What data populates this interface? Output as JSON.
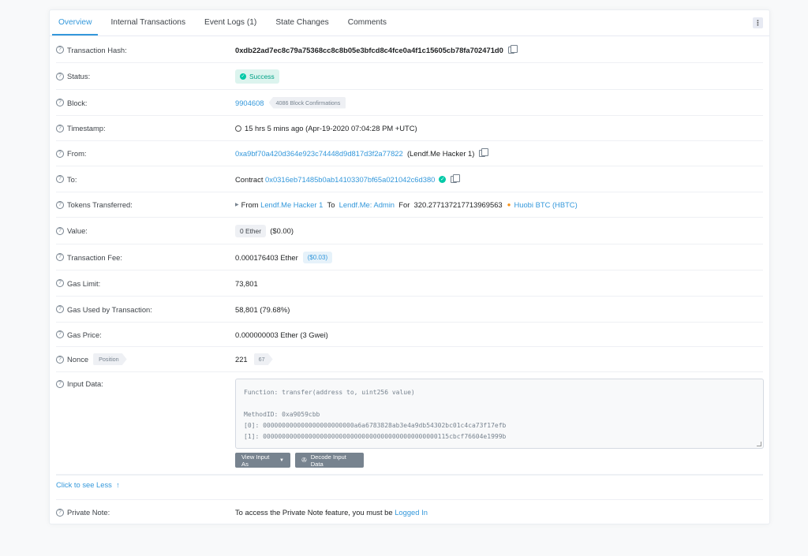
{
  "tabs": [
    "Overview",
    "Internal Transactions",
    "Event Logs (1)",
    "State Changes",
    "Comments"
  ],
  "kebab": "⋮",
  "rows": {
    "hash": {
      "label": "Transaction Hash:",
      "value": "0xdb22ad7ec8c79a75368cc8c8b05e3bfcd8c4fce0a4f1c15605cb78fa702471d0"
    },
    "status": {
      "label": "Status:",
      "value": "Success"
    },
    "block": {
      "label": "Block:",
      "number": "9904608",
      "confirmations": "4086 Block Confirmations"
    },
    "timestamp": {
      "label": "Timestamp:",
      "value": "15 hrs 5 mins ago (Apr-19-2020 07:04:28 PM +UTC)"
    },
    "from": {
      "label": "From:",
      "address": "0xa9bf70a420d364e923c74448d9d817d3f2a77822",
      "name": "(Lendf.Me Hacker 1)"
    },
    "to": {
      "label": "To:",
      "prefix": "Contract",
      "address": "0x0316eb71485b0ab14103307bf65a021042c6d380"
    },
    "tokens": {
      "label": "Tokens Transferred:",
      "from_word": "From",
      "from_name": "Lendf.Me Hacker 1",
      "to_word": "To",
      "to_name": "Lendf.Me: Admin",
      "for_word": "For",
      "amount": "320.277137217713969563",
      "token": "Huobi BTC (HBTC)"
    },
    "value": {
      "label": "Value:",
      "ether": "0 Ether",
      "usd": "($0.00)"
    },
    "fee": {
      "label": "Transaction Fee:",
      "ether": "0.000176403 Ether",
      "usd": "($0.03)"
    },
    "gas_limit": {
      "label": "Gas Limit:",
      "value": "73,801"
    },
    "gas_used": {
      "label": "Gas Used by Transaction:",
      "value": "58,801 (79.68%)"
    },
    "gas_price": {
      "label": "Gas Price:",
      "value": "0.000000003 Ether (3 Gwei)"
    },
    "nonce": {
      "label": "Nonce",
      "position_label": "Position",
      "value": "221",
      "position": "67"
    },
    "input": {
      "label": "Input Data:",
      "function": "Function: transfer(address to, uint256 value)",
      "method": "MethodID: 0xa9059cbb",
      "arg0": "[0]:  000000000000000000000000a6a6783828ab3e4a9db54302bc01c4ca73f17efb",
      "arg1": "[1]:  0000000000000000000000000000000000000000000000115cbcf76604e1999b",
      "view_as": "View Input As",
      "decode": "Decode Input Data"
    },
    "see_less": "Click to see Less",
    "private_note": {
      "label": "Private Note:",
      "text": "To access the Private Note feature, you must be",
      "link": "Logged In"
    }
  },
  "colors": {
    "accent": "#3498db",
    "success": "#00c9a7",
    "btn": "#77838f"
  }
}
